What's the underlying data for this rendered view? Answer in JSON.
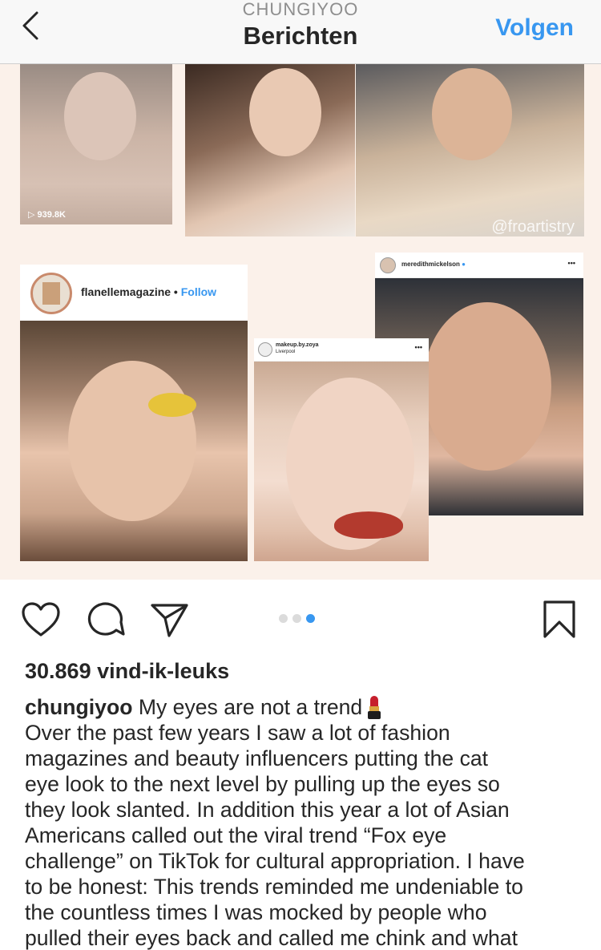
{
  "header": {
    "username": "CHUNGIYOO",
    "title": "Berichten",
    "follow_label": "Volgen"
  },
  "post_image": {
    "tile1_views": "939.8K",
    "tile3_watermark": "@froartistry",
    "card_a": {
      "username": "flanellemagazine",
      "separator": " • ",
      "follow": "Follow"
    },
    "card_b": {
      "username": "makeup.by.zoya",
      "location": "Liverpool",
      "more": "•••"
    },
    "card_c": {
      "username": "meredithmickelson",
      "verified": "●",
      "more": "•••"
    },
    "carousel": {
      "count": 3,
      "active_index": 2
    }
  },
  "actions": {
    "like_icon": "heart-icon",
    "comment_icon": "comment-icon",
    "share_icon": "paper-plane-icon",
    "save_icon": "bookmark-icon"
  },
  "likes": "30.869 vind-ik-leuks",
  "caption": {
    "username": "chungiyoo",
    "headline": "My eyes are not a trend",
    "emoji": "lipstick",
    "lines": [
      "Over the past few years I saw a lot of fashion",
      "magazines and beauty influencers putting the cat",
      "eye look to the next level by pulling up the eyes so",
      "they look slanted. In addition this year a lot of Asian",
      "Americans called out the viral trend “Fox eye",
      "challenge” on TikTok for cultural appropriation. I have",
      "to be honest: This trends reminded me undeniable to",
      "the countless times I was mocked by people who",
      "pulled their eyes back and called me chink and what"
    ]
  },
  "colors": {
    "accent": "#3897f0",
    "text": "#262626",
    "muted": "#8e8e8e",
    "image_bg": "#fbf1ea"
  }
}
